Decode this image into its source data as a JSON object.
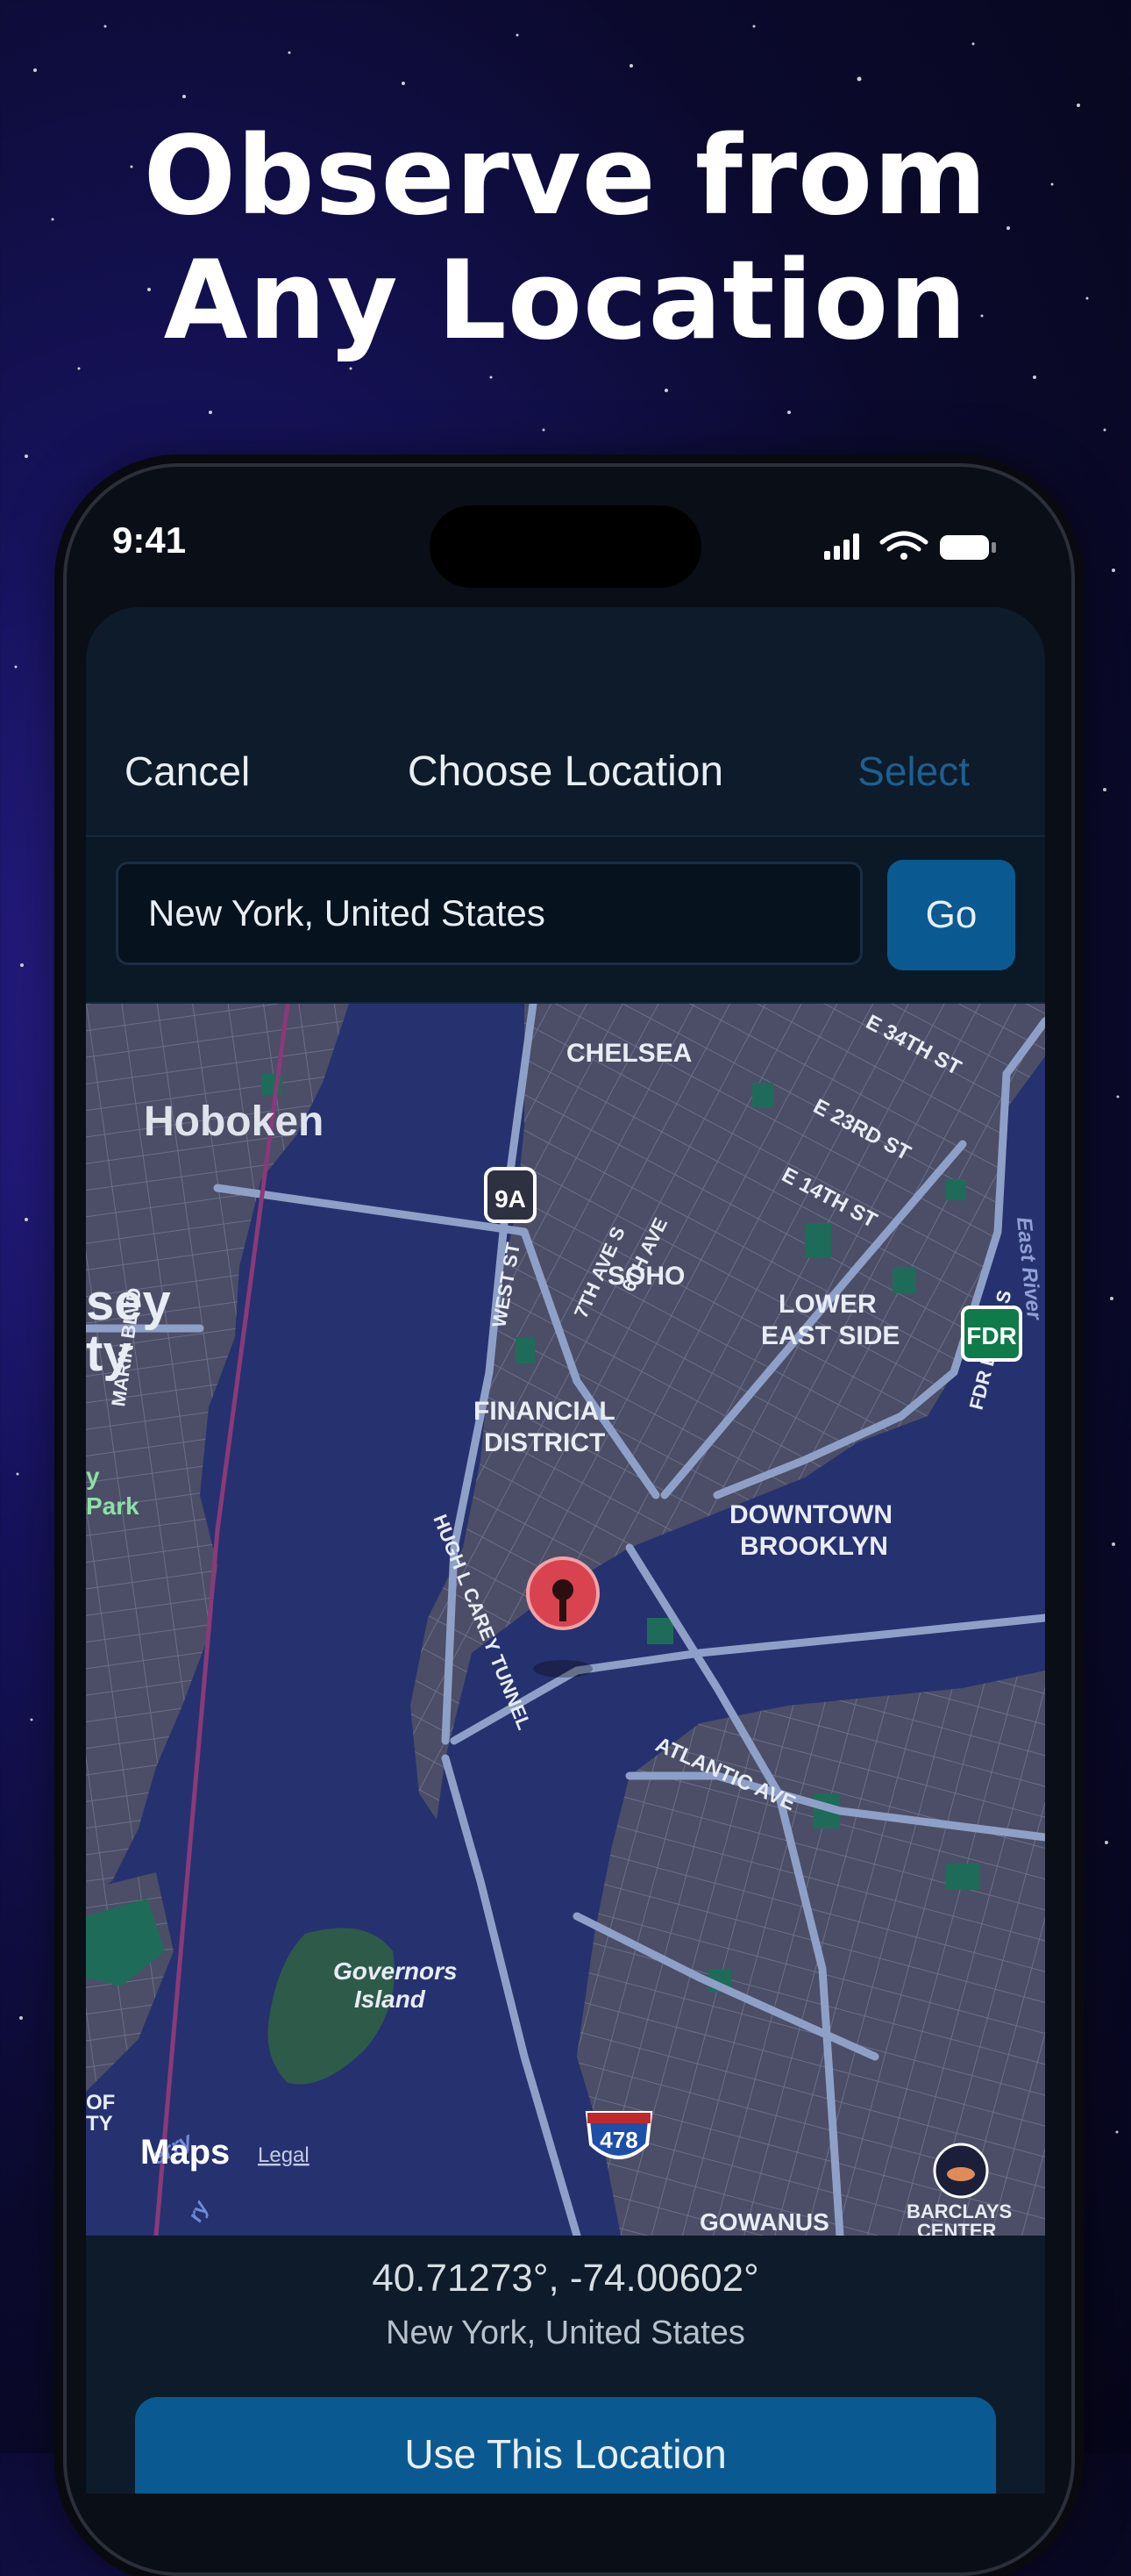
{
  "marketing": {
    "headline_line1": "Observe from",
    "headline_line2": "Any Location"
  },
  "status_bar": {
    "time": "9:41"
  },
  "nav": {
    "cancel": "Cancel",
    "title": "Choose Location",
    "select": "Select"
  },
  "search": {
    "value": "New York, United States",
    "go": "Go"
  },
  "map": {
    "labels": {
      "chelsea": "CHELSEA",
      "hoboken": "Hoboken",
      "soho": "SOHO",
      "lower_east_side_1": "LOWER",
      "lower_east_side_2": "EAST SIDE",
      "financial_1": "FINANCIAL",
      "financial_2": "DISTRICT",
      "downtown_1": "DOWNTOWN",
      "downtown_2": "BROOKLYN",
      "governors_1": "Governors",
      "governors_2": "Island",
      "jersey_1": "sey",
      "jersey_2": "ty",
      "park_1": "y",
      "park_2": "Park",
      "of_1": "OF",
      "of_2": "TY",
      "gowanus": "GOWANUS",
      "barclays_1": "BARCLAYS",
      "barclays_2": "CENTER",
      "e34": "E 34TH ST",
      "e23": "E 23RD ST",
      "e14": "E 14TH ST",
      "west_st": "WEST ST",
      "ave7": "7TH AVE S",
      "ave6": "6TH AVE",
      "fdr_drive": "FDR DRIVE S",
      "east_river": "East River",
      "marin": "MARIN BLVD",
      "hugh": "HUGH L CAREY TUNNEL",
      "atlantic": "ATLANTIC AVE",
      "ferry": "erry",
      "ferry2": "ry"
    },
    "shields": {
      "route_9a": "9A",
      "fdr": "FDR",
      "i478": "478"
    },
    "attribution": {
      "maps": "Maps",
      "legal": "Legal"
    }
  },
  "selection": {
    "coords": "40.71273°, -74.00602°",
    "place": "New York, United States"
  },
  "use_button": "Use This Location",
  "colors": {
    "accent": "#0a5a91",
    "select_disabled": "#1e5f8f",
    "pin": "#d9434f"
  }
}
